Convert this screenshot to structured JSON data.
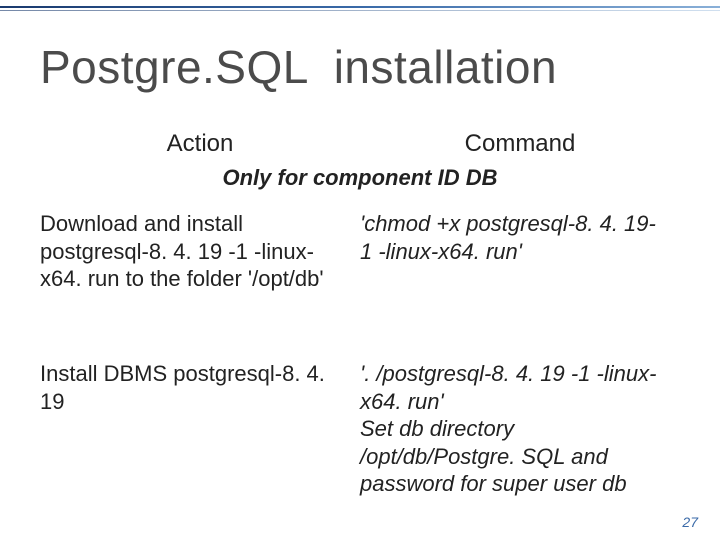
{
  "title": "Postgre.SQL  installation",
  "columns": {
    "action": "Action",
    "command": "Command"
  },
  "section_subtitle": "Only for component ID DB",
  "rows": [
    {
      "action": "Download and install postgresql-8. 4. 19 -1 -linux-x64. run to the folder '/opt/db'",
      "command": "'chmod +x postgresql-8. 4. 19-1 -linux-x64. run'"
    },
    {
      "action": "Install DBMS postgresql-8. 4. 19",
      "command": "'. /postgresql-8. 4. 19 -1 -linux-x64. run'\nSet db directory /opt/db/Postgre. SQL and password for super user db"
    }
  ],
  "page_number": "27"
}
